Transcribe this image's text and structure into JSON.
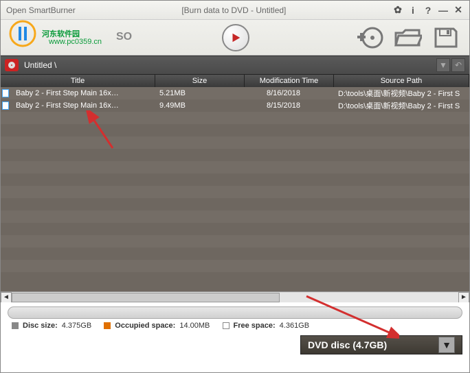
{
  "titlebar": {
    "app_title": "Open SmartBurner",
    "doc_title": "[Burn data to DVD - Untitled]"
  },
  "watermark": {
    "text": "河东软件园",
    "url": "www.pc0359.cn"
  },
  "toolbar": {
    "iso_text": "SO"
  },
  "breadcrumb": {
    "label": "Untitled \\"
  },
  "columns": {
    "title": "Title",
    "size": "Size",
    "mod": "Modification Time",
    "path": "Source Path"
  },
  "rows": [
    {
      "title": "Baby 2 - First Step Main 16x…",
      "size": "5.21MB",
      "mod": "8/16/2018",
      "path": "D:\\tools\\桌面\\新视频\\Baby 2 - First S"
    },
    {
      "title": "Baby 2 - First Step Main 16x…",
      "size": "9.49MB",
      "mod": "8/15/2018",
      "path": "D:\\tools\\桌面\\新视频\\Baby 2 - First S"
    }
  ],
  "disc_info": {
    "disc_size_label": "Disc size:",
    "disc_size_value": "4.375GB",
    "occupied_label": "Occupied space:",
    "occupied_value": "14.00MB",
    "free_label": "Free space:",
    "free_value": "4.361GB"
  },
  "disc_select": {
    "label": "DVD disc (4.7GB)"
  }
}
